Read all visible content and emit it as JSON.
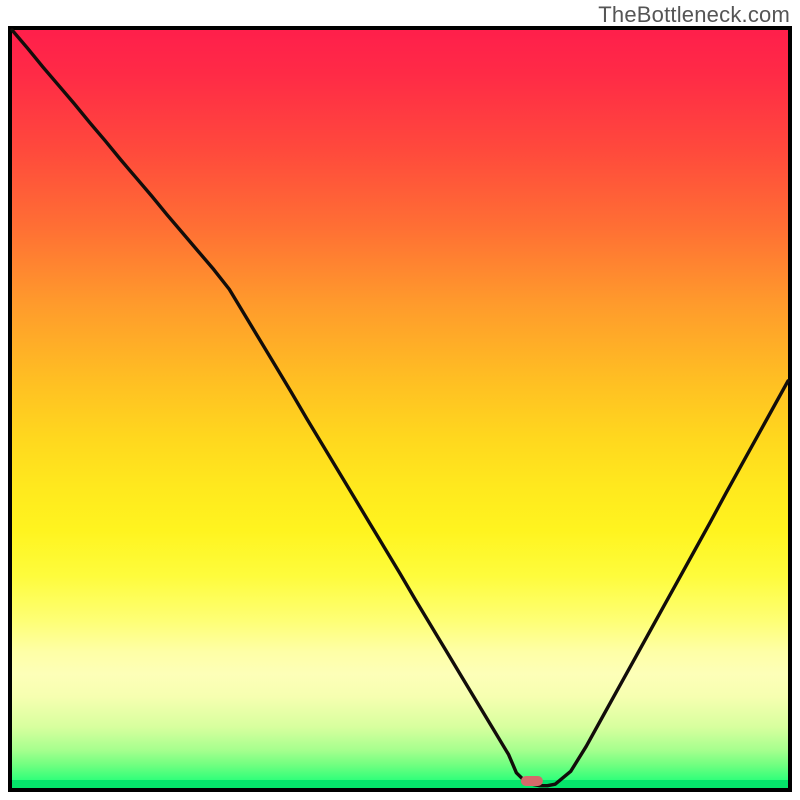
{
  "watermark": "TheBottleneck.com",
  "chart_data": {
    "type": "line",
    "title": "",
    "xlabel": "",
    "ylabel": "",
    "x": [
      0,
      2,
      4,
      6,
      8,
      10,
      12,
      14,
      16,
      18,
      20,
      22,
      24,
      26,
      28,
      30,
      32,
      34,
      36,
      38,
      40,
      42,
      44,
      46,
      48,
      50,
      52,
      54,
      56,
      58,
      60,
      62,
      64,
      65,
      66,
      67,
      68,
      69,
      70,
      72,
      74,
      76,
      78,
      80,
      82,
      84,
      86,
      88,
      90,
      92,
      94,
      96,
      98,
      100
    ],
    "values": [
      100,
      97.6,
      95.1,
      92.7,
      90.3,
      87.8,
      85.4,
      82.9,
      80.5,
      78.1,
      75.6,
      73.2,
      70.8,
      68.4,
      65.8,
      62.4,
      59.0,
      55.6,
      52.2,
      48.7,
      45.3,
      41.9,
      38.5,
      35.1,
      31.7,
      28.3,
      24.8,
      21.4,
      18.0,
      14.6,
      11.2,
      7.8,
      4.4,
      2.0,
      1.0,
      0.5,
      0.3,
      0.3,
      0.5,
      2.2,
      5.5,
      9.2,
      12.9,
      16.6,
      20.3,
      24.0,
      27.7,
      31.4,
      35.1,
      38.9,
      42.6,
      46.3,
      50.0,
      53.7
    ],
    "xlim": [
      0,
      100
    ],
    "ylim": [
      0,
      100
    ],
    "min_marker_x": 67
  }
}
